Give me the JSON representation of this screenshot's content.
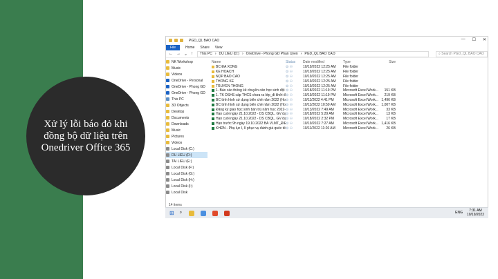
{
  "colors": {
    "green": "#3a7d4e",
    "dark": "#2b2b2b",
    "accent": "#1a62c4"
  },
  "slide": {
    "title": "Xử lý lỗi báo đỏ khi đồng bộ dữ liệu trên Onedriver Office 365"
  },
  "window": {
    "title": "PGD_QL BAO CAO",
    "tabs": [
      "File",
      "Home",
      "Share",
      "View"
    ],
    "breadcrumb": [
      "This PC",
      "DU LIEU (D:)",
      "OneDrive - Phong GD Phan Uyen",
      "PGD_QL BAO CAO"
    ],
    "search_placeholder": "Search PGD_QL BAO CAO",
    "status": "14 items",
    "controls": [
      "—",
      "☐",
      "✕"
    ],
    "nav_items": [
      {
        "label": "NK Workshop",
        "icon": "folder-icon"
      },
      {
        "label": "Music",
        "icon": "folder-icon"
      },
      {
        "label": "Videos",
        "icon": "folder-icon"
      },
      {
        "label": "OneDrive - Personal",
        "icon": "cloud-icon"
      },
      {
        "label": "OneDrive - Phong GD",
        "icon": "cloud-icon"
      },
      {
        "label": "OneDrive - Phong GD",
        "icon": "cloud-icon"
      },
      {
        "label": "This PC",
        "icon": "pc-icon"
      },
      {
        "label": "3D Objects",
        "icon": "folder-icon"
      },
      {
        "label": "Desktop",
        "icon": "folder-icon"
      },
      {
        "label": "Documents",
        "icon": "folder-icon"
      },
      {
        "label": "Downloads",
        "icon": "folder-icon"
      },
      {
        "label": "Music",
        "icon": "folder-icon"
      },
      {
        "label": "Pictures",
        "icon": "folder-icon"
      },
      {
        "label": "Videos",
        "icon": "folder-icon"
      },
      {
        "label": "Local Disk (C:)",
        "icon": "drive-icon"
      },
      {
        "label": "DU LIEU (D:)",
        "icon": "drive-icon",
        "selected": true
      },
      {
        "label": "TAI LIEU (E:)",
        "icon": "drive-icon"
      },
      {
        "label": "Local Disk (F:)",
        "icon": "drive-icon"
      },
      {
        "label": "Local Disk (G:)",
        "icon": "drive-icon"
      },
      {
        "label": "Local Disk (H:)",
        "icon": "drive-icon"
      },
      {
        "label": "Local Disk (I:)",
        "icon": "drive-icon"
      },
      {
        "label": "Local Disk",
        "icon": "drive-icon"
      }
    ],
    "columns": [
      "Name",
      "Status",
      "Date modified",
      "Type",
      "Size"
    ],
    "files": [
      {
        "name": "BC ĐÃ XONG",
        "status": "⊙ ⚇",
        "date": "10/19/2022 12:25 AM",
        "type": "File folder",
        "size": "",
        "kind": "folder"
      },
      {
        "name": "KẾ HOẠCH",
        "status": "⊙ ⚇",
        "date": "10/19/2022 12:25 AM",
        "type": "File folder",
        "size": "",
        "kind": "folder"
      },
      {
        "name": "NỘP BÁO CÁO",
        "status": "⊙ ⚇",
        "date": "10/19/2022 12:25 AM",
        "type": "File folder",
        "size": "",
        "kind": "folder"
      },
      {
        "name": "THỐNG KÊ",
        "status": "⊙ ⚇",
        "date": "10/19/2022 12:25 AM",
        "type": "File folder",
        "size": "",
        "kind": "folder"
      },
      {
        "name": "TRUYỀN THÔNG",
        "status": "⊙ ⚇",
        "date": "10/19/2022 12:25 AM",
        "type": "File folder",
        "size": "",
        "kind": "folder"
      },
      {
        "name": "1. Báo cáo thống kê chuyên cần học sinh đội ng...",
        "status": "⊙ ⚇",
        "date": "10/18/2022 11:19 PM",
        "type": "Microsoft Excel Work...",
        "size": "151 KB",
        "kind": "excel"
      },
      {
        "name": "1. TK DSHS cấp THCS chưa ra lớp_đi khởi địa b...",
        "status": "⊙ ⚇",
        "date": "10/19/2022 11:19 PM",
        "type": "Microsoft Excel Work...",
        "size": "219 KB",
        "kind": "excel"
      },
      {
        "name": "BC tình hình sử dụng biên chế năm 2022 (Hoàn...",
        "status": "⊙ ⚇",
        "date": "10/11/2022 4:41 PM",
        "type": "Microsoft Excel Work...",
        "size": "1,496 KB",
        "kind": "excel"
      },
      {
        "name": "BC tình hình sử dụng biên chế năm 2022 (Hoàn...",
        "status": "⊙ ⚇",
        "date": "10/11/2022 10:50 AM",
        "type": "Microsoft Excel Work...",
        "size": "1,007 KB",
        "kind": "excel"
      },
      {
        "name": "Đăng ký giao học sinh bán trú năm học 2022-2...",
        "status": "⊙ ⚇",
        "date": "10/13/2022 7:49 AM",
        "type": "Microsoft Excel Work...",
        "size": "33 KB",
        "kind": "excel"
      },
      {
        "name": "Hạn cuối ngày 21.10.2022 - DS CBQL, GV dạy c...",
        "status": "⊙ ⚇",
        "date": "10/18/2022 5:29 AM",
        "type": "Microsoft Excel Work...",
        "size": "13 KB",
        "kind": "excel"
      },
      {
        "name": "Hạn cuối ngày 21.10.2022 - DS CBQL, GV dạy c...",
        "status": "⊙ ⚇",
        "date": "10/18/2022 2:32 PM",
        "type": "Microsoft Excel Work...",
        "size": "17 KB",
        "kind": "excel"
      },
      {
        "name": "Hạn trước 9h ngày 19.10.2022 BÁ VLMT_ĐIỀU...",
        "status": "⊙ ⚇",
        "date": "10/19/2022 7:27 AM",
        "type": "Microsoft Excel Work...",
        "size": "1,416 KB",
        "kind": "excel"
      },
      {
        "name": "KHĐN - Phụ lục I, II phục vụ đánh giá quốc tế",
        "status": "⊙ ⚇",
        "date": "10/11/2022 11:26 AM",
        "type": "Microsoft Excel Work...",
        "size": "26 KB",
        "kind": "excel"
      }
    ]
  },
  "taskbar": {
    "start": "⊞",
    "search": "⌕",
    "apps": [
      {
        "name": "explorer",
        "color": "#e8bb3c"
      },
      {
        "name": "chrome",
        "color": "#4a8fe0"
      },
      {
        "name": "app3",
        "color": "#e04a2b"
      },
      {
        "name": "app4",
        "color": "#d23a1f"
      }
    ],
    "lang": "ENG",
    "time": "7:31 AM",
    "date": "10/19/2022"
  }
}
